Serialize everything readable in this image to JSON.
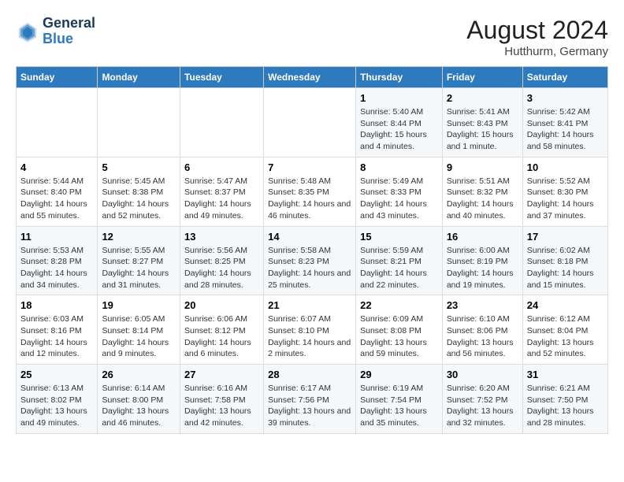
{
  "logo": {
    "line1": "General",
    "line2": "Blue"
  },
  "title": "August 2024",
  "location": "Hutthurm, Germany",
  "days_of_week": [
    "Sunday",
    "Monday",
    "Tuesday",
    "Wednesday",
    "Thursday",
    "Friday",
    "Saturday"
  ],
  "weeks": [
    [
      {
        "day": "",
        "sunrise": "",
        "sunset": "",
        "daylight": ""
      },
      {
        "day": "",
        "sunrise": "",
        "sunset": "",
        "daylight": ""
      },
      {
        "day": "",
        "sunrise": "",
        "sunset": "",
        "daylight": ""
      },
      {
        "day": "",
        "sunrise": "",
        "sunset": "",
        "daylight": ""
      },
      {
        "day": "1",
        "sunrise": "Sunrise: 5:40 AM",
        "sunset": "Sunset: 8:44 PM",
        "daylight": "Daylight: 15 hours and 4 minutes."
      },
      {
        "day": "2",
        "sunrise": "Sunrise: 5:41 AM",
        "sunset": "Sunset: 8:43 PM",
        "daylight": "Daylight: 15 hours and 1 minute."
      },
      {
        "day": "3",
        "sunrise": "Sunrise: 5:42 AM",
        "sunset": "Sunset: 8:41 PM",
        "daylight": "Daylight: 14 hours and 58 minutes."
      }
    ],
    [
      {
        "day": "4",
        "sunrise": "Sunrise: 5:44 AM",
        "sunset": "Sunset: 8:40 PM",
        "daylight": "Daylight: 14 hours and 55 minutes."
      },
      {
        "day": "5",
        "sunrise": "Sunrise: 5:45 AM",
        "sunset": "Sunset: 8:38 PM",
        "daylight": "Daylight: 14 hours and 52 minutes."
      },
      {
        "day": "6",
        "sunrise": "Sunrise: 5:47 AM",
        "sunset": "Sunset: 8:37 PM",
        "daylight": "Daylight: 14 hours and 49 minutes."
      },
      {
        "day": "7",
        "sunrise": "Sunrise: 5:48 AM",
        "sunset": "Sunset: 8:35 PM",
        "daylight": "Daylight: 14 hours and 46 minutes."
      },
      {
        "day": "8",
        "sunrise": "Sunrise: 5:49 AM",
        "sunset": "Sunset: 8:33 PM",
        "daylight": "Daylight: 14 hours and 43 minutes."
      },
      {
        "day": "9",
        "sunrise": "Sunrise: 5:51 AM",
        "sunset": "Sunset: 8:32 PM",
        "daylight": "Daylight: 14 hours and 40 minutes."
      },
      {
        "day": "10",
        "sunrise": "Sunrise: 5:52 AM",
        "sunset": "Sunset: 8:30 PM",
        "daylight": "Daylight: 14 hours and 37 minutes."
      }
    ],
    [
      {
        "day": "11",
        "sunrise": "Sunrise: 5:53 AM",
        "sunset": "Sunset: 8:28 PM",
        "daylight": "Daylight: 14 hours and 34 minutes."
      },
      {
        "day": "12",
        "sunrise": "Sunrise: 5:55 AM",
        "sunset": "Sunset: 8:27 PM",
        "daylight": "Daylight: 14 hours and 31 minutes."
      },
      {
        "day": "13",
        "sunrise": "Sunrise: 5:56 AM",
        "sunset": "Sunset: 8:25 PM",
        "daylight": "Daylight: 14 hours and 28 minutes."
      },
      {
        "day": "14",
        "sunrise": "Sunrise: 5:58 AM",
        "sunset": "Sunset: 8:23 PM",
        "daylight": "Daylight: 14 hours and 25 minutes."
      },
      {
        "day": "15",
        "sunrise": "Sunrise: 5:59 AM",
        "sunset": "Sunset: 8:21 PM",
        "daylight": "Daylight: 14 hours and 22 minutes."
      },
      {
        "day": "16",
        "sunrise": "Sunrise: 6:00 AM",
        "sunset": "Sunset: 8:19 PM",
        "daylight": "Daylight: 14 hours and 19 minutes."
      },
      {
        "day": "17",
        "sunrise": "Sunrise: 6:02 AM",
        "sunset": "Sunset: 8:18 PM",
        "daylight": "Daylight: 14 hours and 15 minutes."
      }
    ],
    [
      {
        "day": "18",
        "sunrise": "Sunrise: 6:03 AM",
        "sunset": "Sunset: 8:16 PM",
        "daylight": "Daylight: 14 hours and 12 minutes."
      },
      {
        "day": "19",
        "sunrise": "Sunrise: 6:05 AM",
        "sunset": "Sunset: 8:14 PM",
        "daylight": "Daylight: 14 hours and 9 minutes."
      },
      {
        "day": "20",
        "sunrise": "Sunrise: 6:06 AM",
        "sunset": "Sunset: 8:12 PM",
        "daylight": "Daylight: 14 hours and 6 minutes."
      },
      {
        "day": "21",
        "sunrise": "Sunrise: 6:07 AM",
        "sunset": "Sunset: 8:10 PM",
        "daylight": "Daylight: 14 hours and 2 minutes."
      },
      {
        "day": "22",
        "sunrise": "Sunrise: 6:09 AM",
        "sunset": "Sunset: 8:08 PM",
        "daylight": "Daylight: 13 hours and 59 minutes."
      },
      {
        "day": "23",
        "sunrise": "Sunrise: 6:10 AM",
        "sunset": "Sunset: 8:06 PM",
        "daylight": "Daylight: 13 hours and 56 minutes."
      },
      {
        "day": "24",
        "sunrise": "Sunrise: 6:12 AM",
        "sunset": "Sunset: 8:04 PM",
        "daylight": "Daylight: 13 hours and 52 minutes."
      }
    ],
    [
      {
        "day": "25",
        "sunrise": "Sunrise: 6:13 AM",
        "sunset": "Sunset: 8:02 PM",
        "daylight": "Daylight: 13 hours and 49 minutes."
      },
      {
        "day": "26",
        "sunrise": "Sunrise: 6:14 AM",
        "sunset": "Sunset: 8:00 PM",
        "daylight": "Daylight: 13 hours and 46 minutes."
      },
      {
        "day": "27",
        "sunrise": "Sunrise: 6:16 AM",
        "sunset": "Sunset: 7:58 PM",
        "daylight": "Daylight: 13 hours and 42 minutes."
      },
      {
        "day": "28",
        "sunrise": "Sunrise: 6:17 AM",
        "sunset": "Sunset: 7:56 PM",
        "daylight": "Daylight: 13 hours and 39 minutes."
      },
      {
        "day": "29",
        "sunrise": "Sunrise: 6:19 AM",
        "sunset": "Sunset: 7:54 PM",
        "daylight": "Daylight: 13 hours and 35 minutes."
      },
      {
        "day": "30",
        "sunrise": "Sunrise: 6:20 AM",
        "sunset": "Sunset: 7:52 PM",
        "daylight": "Daylight: 13 hours and 32 minutes."
      },
      {
        "day": "31",
        "sunrise": "Sunrise: 6:21 AM",
        "sunset": "Sunset: 7:50 PM",
        "daylight": "Daylight: 13 hours and 28 minutes."
      }
    ]
  ]
}
